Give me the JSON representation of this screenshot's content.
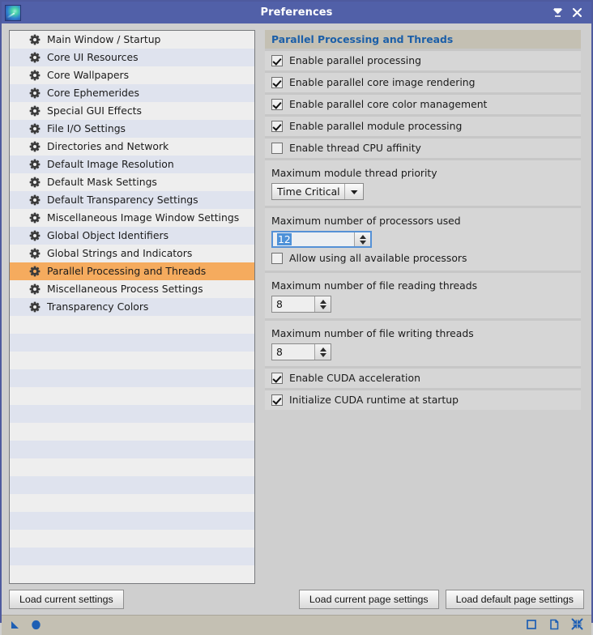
{
  "window": {
    "title": "Preferences",
    "app_icon": "comet-icon",
    "minimize_label": "⬍",
    "close_label": "✕",
    "accent_titlebar": "#5160a8",
    "selection_color": "#f5ab5e",
    "header_text_color": "#1c5fa8"
  },
  "sidebar": {
    "items": [
      {
        "label": "Main Window / Startup",
        "icon": "gear-icon",
        "selected": false
      },
      {
        "label": "Core UI Resources",
        "icon": "gear-icon",
        "selected": false
      },
      {
        "label": "Core Wallpapers",
        "icon": "gear-icon",
        "selected": false
      },
      {
        "label": "Core Ephemerides",
        "icon": "gear-icon",
        "selected": false
      },
      {
        "label": "Special GUI Effects",
        "icon": "gear-icon",
        "selected": false
      },
      {
        "label": "File I/O Settings",
        "icon": "gear-icon",
        "selected": false
      },
      {
        "label": "Directories and Network",
        "icon": "gear-icon",
        "selected": false
      },
      {
        "label": "Default Image Resolution",
        "icon": "gear-icon",
        "selected": false
      },
      {
        "label": "Default Mask Settings",
        "icon": "gear-icon",
        "selected": false
      },
      {
        "label": "Default Transparency Settings",
        "icon": "gear-icon",
        "selected": false
      },
      {
        "label": "Miscellaneous Image Window Settings",
        "icon": "gear-icon",
        "selected": false
      },
      {
        "label": "Global Object Identifiers",
        "icon": "gear-icon",
        "selected": false
      },
      {
        "label": "Global Strings and Indicators",
        "icon": "gear-icon",
        "selected": false
      },
      {
        "label": "Parallel Processing and Threads",
        "icon": "gear-icon",
        "selected": true
      },
      {
        "label": "Miscellaneous Process Settings",
        "icon": "gear-icon",
        "selected": false
      },
      {
        "label": "Transparency Colors",
        "icon": "gear-icon",
        "selected": false
      }
    ],
    "empty_row_count": 15
  },
  "panel": {
    "header": "Parallel Processing and Threads",
    "rows": [
      {
        "kind": "checkbox",
        "label": "Enable parallel processing",
        "checked": true,
        "name": "enable-parallel-processing"
      },
      {
        "kind": "checkbox",
        "label": "Enable parallel core image rendering",
        "checked": true,
        "name": "enable-parallel-core-image-rendering"
      },
      {
        "kind": "checkbox",
        "label": "Enable parallel core color management",
        "checked": true,
        "name": "enable-parallel-core-color-management"
      },
      {
        "kind": "checkbox",
        "label": "Enable parallel module processing",
        "checked": true,
        "name": "enable-parallel-module-processing"
      },
      {
        "kind": "checkbox",
        "label": "Enable thread CPU affinity",
        "checked": false,
        "name": "enable-thread-cpu-affinity"
      },
      {
        "kind": "combo",
        "label": "Maximum module thread priority",
        "value": "Time Critical",
        "name": "maximum-module-thread-priority"
      },
      {
        "kind": "spin-with-checkbox",
        "label": "Maximum number of processors used",
        "value": "12",
        "focused": true,
        "sub_label": "Allow using all available processors",
        "sub_checked": false,
        "name": "maximum-number-of-processors-used",
        "sub_name": "allow-using-all-available-processors"
      },
      {
        "kind": "spin",
        "label": "Maximum number of file reading threads",
        "value": "8",
        "focused": false,
        "name": "maximum-file-reading-threads"
      },
      {
        "kind": "spin",
        "label": "Maximum number of file writing threads",
        "value": "8",
        "focused": false,
        "name": "maximum-file-writing-threads"
      },
      {
        "kind": "checkbox",
        "label": "Enable CUDA acceleration",
        "checked": true,
        "name": "enable-cuda-acceleration"
      },
      {
        "kind": "checkbox",
        "label": "Initialize CUDA runtime at startup",
        "checked": true,
        "name": "initialize-cuda-runtime-at-startup"
      }
    ]
  },
  "buttons": {
    "load_current_settings": "Load current settings",
    "load_current_page_settings": "Load current page settings",
    "load_default_page_settings": "Load default page settings"
  },
  "statusbar": {
    "left_icons": [
      "cursor-arrow-icon",
      "filled-circle-icon"
    ],
    "right_icons": [
      "square-icon",
      "new-document-icon",
      "collapse-arrows-icon"
    ],
    "icon_color": "#1e5fb4"
  }
}
